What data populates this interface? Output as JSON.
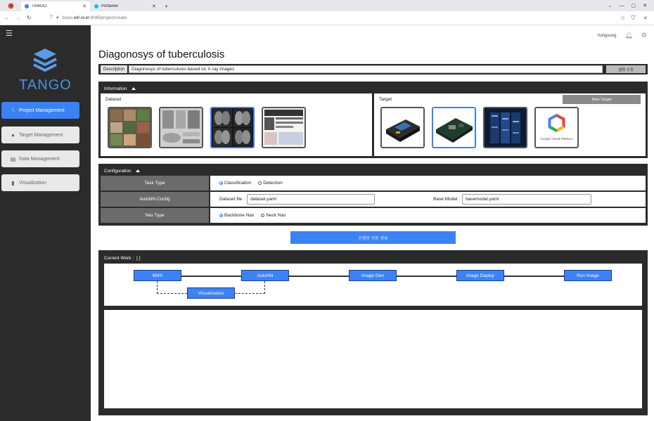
{
  "browser": {
    "tabs": [
      {
        "label": "TANGO",
        "active": true
      },
      {
        "label": "Portainer",
        "active": false
      }
    ],
    "url": {
      "prefix": "bravo.",
      "host": "etri.re.kr",
      "path": ":8085/project/create"
    }
  },
  "sidebar": {
    "logo_text": "TANGO",
    "items": [
      {
        "label": "Project Management",
        "icon": "project-icon",
        "active": true
      },
      {
        "label": "Target Management",
        "icon": "target-icon",
        "active": false
      },
      {
        "label": "Data Management",
        "icon": "database-icon",
        "active": false
      },
      {
        "label": "Visualization",
        "icon": "chart-icon",
        "active": false
      }
    ]
  },
  "header": {
    "username": "hongsoog"
  },
  "page": {
    "title": "Diagonosys of tuberculosis",
    "description_label": "Description",
    "description_value": "Diagonosys of tuberculosis based on X-ray images",
    "description_button": "설명 수정"
  },
  "information": {
    "title": "Information",
    "dataset_label": "Dataset",
    "target_label": "Target",
    "new_target_label": "New Target",
    "google_cloud_text": "Google Cloud Platform"
  },
  "configuration": {
    "title": "Configuration",
    "task_type_label": "Task Type",
    "task_classification": "Classification",
    "task_detection": "Detection",
    "autonn_label": "AutoNN Config",
    "dataset_file_label": "Dataset file :",
    "dataset_file_value": "dataset.yaml",
    "base_model_label": "Base Model :",
    "base_model_value": "basemodel.yaml",
    "nas_label": "Nas Type",
    "nas_backbone": "Backbone Nas",
    "nas_neck": "Neck Nas"
  },
  "generate_button": "신경망 자동 생성",
  "current_work": {
    "label": "Current Work :",
    "value": "[    ]",
    "nodes": {
      "bms": "BMS",
      "autonn": "AutoNN",
      "image_gen": "Image Gen",
      "image_deploy": "Image Deploy",
      "run_image": "Run Image",
      "visualization": "Visualization"
    }
  },
  "colors": {
    "accent": "#3b82f6",
    "dark": "#2b2b2b",
    "logo": "#4a90e2"
  }
}
